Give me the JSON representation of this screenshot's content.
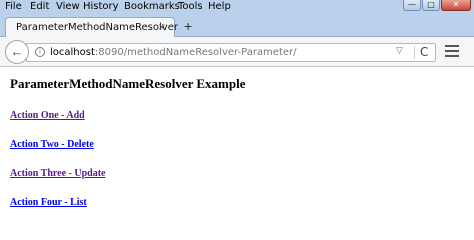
{
  "menubar": {
    "items": [
      "File",
      "Edit",
      "View",
      "History",
      "Bookmarks",
      "Tools",
      "Help"
    ],
    "minimize_glyph": "—",
    "maximize_glyph": "□",
    "close_glyph": "✕"
  },
  "tab": {
    "title": "ParameterMethodNameResolver",
    "close_glyph": "×",
    "new_tab_glyph": "+"
  },
  "navbar": {
    "back_glyph": "←",
    "url_host": "localhost",
    "url_rest": ":8090/methodNameResolver-Parameter/",
    "dropdown_glyph": "▽",
    "reload_glyph": "C"
  },
  "page": {
    "heading": "ParameterMethodNameResolver Example",
    "links": [
      {
        "label": "Action One - Add",
        "visited": true
      },
      {
        "label": "Action Two - Delete",
        "visited": false
      },
      {
        "label": "Action Three - Update",
        "visited": true
      },
      {
        "label": "Action Four - List",
        "visited": false
      }
    ]
  },
  "colors": {
    "chrome_background": "#b9d1ea",
    "visited_link": "#551a8b",
    "unvisited_link": "#0000ee"
  }
}
